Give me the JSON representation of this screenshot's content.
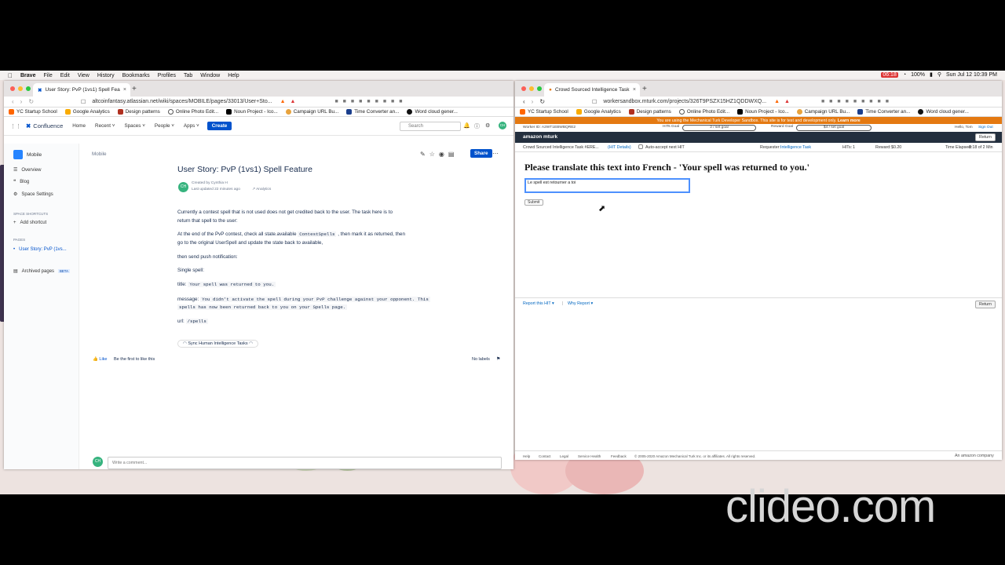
{
  "menubar": {
    "app": "Brave",
    "items": [
      "File",
      "Edit",
      "View",
      "History",
      "Bookmarks",
      "Profiles",
      "Tab",
      "Window",
      "Help"
    ],
    "timer": "06:18",
    "battery": "100%",
    "datetime": "Sun Jul 12  10:39 PM"
  },
  "left_window": {
    "tab_title": "User Story: PvP (1vs1) Spell Fea",
    "url": "altcoinfantasy.atlassian.net/wiki/spaces/MOBILE/pages/33013/User+Sto...",
    "bookmarks": [
      "YC Startup School",
      "Google Analytics",
      "Design patterns",
      "Online Photo Edit...",
      "Noun Project - Ico...",
      "Campaign URL Bu...",
      "Time Converter an...",
      "Word cloud gener..."
    ],
    "nav": {
      "brand": "Confluence",
      "items": [
        "Home",
        "Recent ˅",
        "Spaces ˅",
        "People ˅",
        "Apps ˅"
      ],
      "create": "Create",
      "search_placeholder": "Search",
      "avatar": "CH"
    },
    "sidebar": {
      "space": "Mobile",
      "items": [
        "Overview",
        "Blog",
        "Space Settings"
      ],
      "shortcuts_header": "SPACE SHORTCUTS",
      "add_shortcut": "Add shortcut",
      "pages_header": "PAGES",
      "page_item": "User Story: PvP (1vs...",
      "archived": "Archived pages",
      "beta": "BETA"
    },
    "page": {
      "breadcrumb": "Mobile",
      "share": "Share",
      "title": "User Story: PvP (1vs1) Spell Feature",
      "author": "Created by Cynthia H",
      "updated": "Last updated 22 minutes ago",
      "analytics": "Analytics",
      "p1a": "Currently a contest spell that is not used does not get credited back to the user. The task here is to",
      "p1b": "return that spell to the user:",
      "p2a": "At the end of the PvP contest, check all state.available",
      "p2code": "ContestSpells",
      "p2b": ", then mark it as returned, then",
      "p2c": "go to the original UserSpell and update the state back to available,",
      "p3": "then send push notification:",
      "p4": "Single spell:",
      "title_label": "title:",
      "title_code": "Your spell was returned to you.",
      "msg_label": "message:",
      "msg_code1": "You didn't activate the spell during your PvP challenge against your opponent. This",
      "msg_code2": "spells has now been returned back to you on your Spells page.",
      "url_label": "url:",
      "url_code": "/spells",
      "sync": "Sync Human Intelligence Tasks",
      "like": "Like",
      "like_first": "Be the first to like this",
      "no_labels": "No labels",
      "comment_placeholder": "Write a comment..."
    }
  },
  "right_window": {
    "tab_title": "Crowd Sourced Intelligence Task",
    "url": "workersandbox.mturk.com/projects/326T9PSZX15HZ1QDDWXQ...",
    "bookmarks": [
      "YC Startup School",
      "Google Analytics",
      "Design patterns",
      "Online Photo Edit...",
      "Noun Project - Ico...",
      "Campaign URL Bu...",
      "Time Converter an...",
      "Word cloud gener..."
    ],
    "banner": "You are using the Mechanical Turk Developer Sandbox. This site is for test and development only.",
    "banner_link": "Learn more",
    "worker_id": "Worker ID: A2WT1EBWBQRE2",
    "hits_goal_label": "HITs Goal",
    "hits_goal_value": "2  /  set goal",
    "reward_goal_label": "Reward Goal",
    "reward_goal_value": "$4  /  set goal",
    "hello": "Hello, Tom",
    "sign_out": "Sign Out",
    "brand": "amazon mturk",
    "return": "Return",
    "task_name": "Crowd Sourced Intelligence Task #ERE...",
    "hit_details": "(HIT Details)",
    "auto_accept": "Auto-accept next HIT",
    "requester_label": "Requester:",
    "requester": "Intelligence Task",
    "hits_label": "HITs:",
    "hits": "1",
    "reward_label": "Reward:",
    "reward": "$0.20",
    "time_label": "Time Elapsed:",
    "time": "0:18 of 2 Min",
    "question": "Please translate this text into French - 'Your spell was returned to you.'",
    "answer": "Le spell est retourner a toi",
    "submit": "Submit",
    "report": "Report this HIT",
    "why": "Why Report",
    "footer": [
      "Help",
      "Contact",
      "Legal",
      "Service Health",
      "Feedback"
    ],
    "copyright": "© 2005-2020 Amazon Mechanical Turk Inc. or its affiliates. All rights reserved.",
    "company": "An amazon company"
  },
  "watermark": "clideo.com"
}
